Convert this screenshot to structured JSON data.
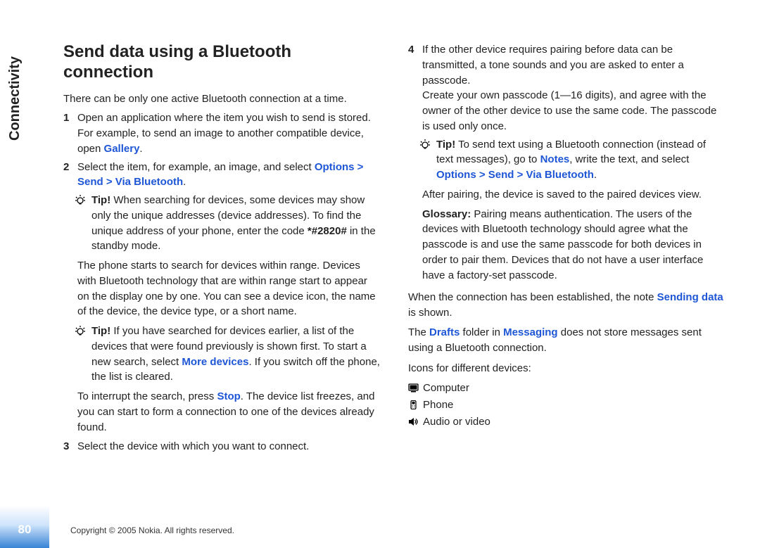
{
  "side": {
    "chapter": "Connectivity",
    "page": "80"
  },
  "heading": "Send data using a Bluetooth connection",
  "intro": "There can be only one active Bluetooth connection at a time.",
  "step1": {
    "num": "1",
    "pre": "Open an application where the item you wish to send is stored. For example, to send an image to another compatible device, open ",
    "gallery": "Gallery",
    "post": "."
  },
  "step2": {
    "num": "2",
    "pre": "Select the item, for example, an image, and select ",
    "path": "Options > Send > Via Bluetooth",
    "post": "."
  },
  "tip1": {
    "label": "Tip!",
    "a": " When searching for devices, some devices may show only the unique addresses (device addresses). To find the unique address of your phone, enter the code ",
    "code": "*#2820#",
    "b": " in the standby mode."
  },
  "para_search": "The phone starts to search for devices within range. Devices with Bluetooth technology that are within range start to appear on the display one by one. You can see a device icon, the name of the device, the device type, or a short name.",
  "tip2": {
    "label": "Tip!",
    "a": " If you have searched for devices earlier, a list of the devices that were found previously is shown first. To start a new search, select ",
    "more": "More devices",
    "b": ". If you switch off the phone, the list is cleared."
  },
  "para_stop": {
    "a": "To interrupt the search, press ",
    "stop": "Stop",
    "b": ". The device list freezes, and you can start to form a connection to one of the devices already found."
  },
  "step3": {
    "num": "3",
    "text": "Select the device with which you want to connect."
  },
  "step4": {
    "num": "4",
    "a": "If the other device requires pairing before data can be transmitted, a tone sounds and you are asked to enter a passcode.",
    "b": "Create your own passcode (1—16 digits), and agree with the owner of the other device to use the same code. The passcode is used only once."
  },
  "tip3": {
    "label": "Tip!",
    "a": " To send text using a Bluetooth connection (instead of text messages), go to ",
    "notes": "Notes",
    "b": ", write the text, and select ",
    "path": "Options > Send > Via Bluetooth",
    "c": "."
  },
  "after_pair": "After pairing, the device is saved to the paired devices view.",
  "glossary": {
    "label": "Glossary:",
    "text": " Pairing means authentication. The users of the devices with Bluetooth technology should agree what the passcode is and use the same passcode for both devices in order to pair them. Devices that do not have a user interface have a factory-set passcode."
  },
  "sending": {
    "a": "When the connection has been established, the note ",
    "b": "Sending data",
    "c": " is shown."
  },
  "drafts": {
    "a": "The ",
    "drafts": "Drafts",
    "b": " folder in ",
    "msg": "Messaging",
    "c": " does not store messages sent using a Bluetooth connection."
  },
  "icons_label": "Icons for different devices:",
  "icon_computer": "Computer",
  "icon_phone": "Phone",
  "icon_audio": "Audio or video",
  "footer": "Copyright © 2005 Nokia. All rights reserved."
}
